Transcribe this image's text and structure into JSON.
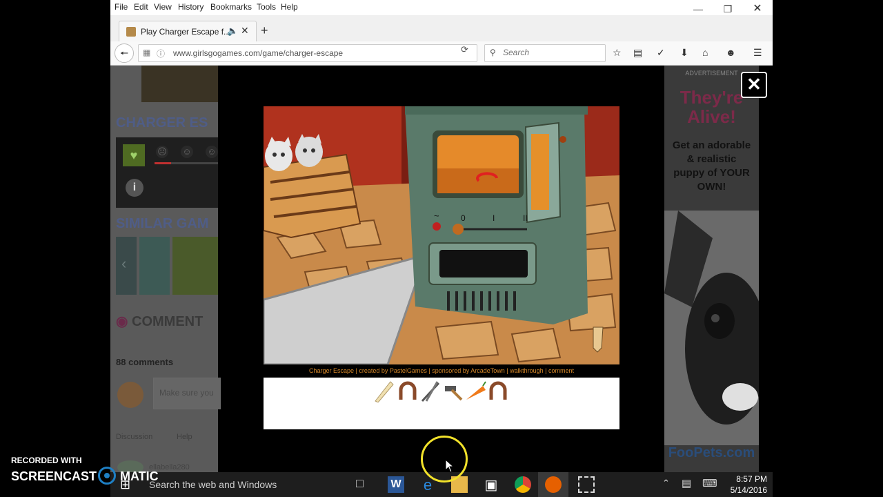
{
  "browser": {
    "menu": [
      "File",
      "Edit",
      "View",
      "History",
      "Bookmarks",
      "Tools",
      "Help"
    ],
    "tab_title": "Play Charger Escape f...",
    "url": "www.girlsgogames.com/game/charger-escape",
    "search_placeholder": "Search"
  },
  "page": {
    "title": "CHARGER ES",
    "similar_title": "SIMILAR GAM",
    "comments_title": "COMMENT",
    "comment_count": "88 comments",
    "comment_placeholder": "Make sure you",
    "discussion_tab": "Discussion",
    "help_tab": "Help",
    "commenter": "ellabella280"
  },
  "game": {
    "credits": "Charger Escape | created by PastelGames | sponsored by ArcadeTown | walkthrough | comment",
    "dial_labels": [
      "~",
      "0",
      "I",
      "II"
    ],
    "inventory": [
      "plank",
      "horseshoe",
      "pliers",
      "hammer",
      "carrot",
      "horseshoe"
    ]
  },
  "ad": {
    "label": "ADVERTISEMENT",
    "headline_1": "They're",
    "headline_2": "Alive!",
    "body": "Get an adorable & realistic puppy of YOUR OWN!",
    "brand": "FooPets.com"
  },
  "taskbar": {
    "search_text": "Search the web and Windows",
    "time": "8:57 PM",
    "date": "5/14/2016"
  },
  "watermark": {
    "line1": "RECORDED WITH",
    "line2a": "SCREENCAST",
    "line2b": "MATIC"
  },
  "colors": {
    "accent_title": "#4f5d87",
    "ad_headline": "#7c2a49",
    "firefox_orange": "#e66000"
  }
}
